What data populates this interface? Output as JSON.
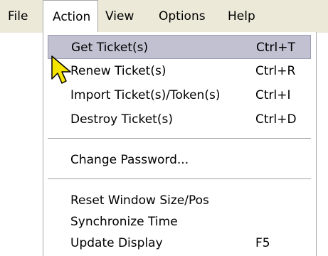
{
  "menubar": {
    "items": [
      {
        "label": "File"
      },
      {
        "label": "Action"
      },
      {
        "label": "View"
      },
      {
        "label": "Options"
      },
      {
        "label": "Help"
      }
    ]
  },
  "action_menu": {
    "items": [
      {
        "label": "Get Ticket(s)",
        "shortcut": "Ctrl+T",
        "highlighted": true
      },
      {
        "label": "Renew Ticket(s)",
        "shortcut": "Ctrl+R"
      },
      {
        "label": "Import Ticket(s)/Token(s)",
        "shortcut": "Ctrl+I"
      },
      {
        "label": "Destroy Ticket(s)",
        "shortcut": "Ctrl+D"
      },
      {
        "label": "Change Password..."
      },
      {
        "label": "Reset Window Size/Pos"
      },
      {
        "label": "Synchronize Time"
      },
      {
        "label": "Update Display",
        "shortcut": "F5"
      }
    ]
  },
  "colors": {
    "menubar_bg": "#ece9d8",
    "highlight_bg": "#c1c1d1",
    "cursor_fill": "#f5e300"
  },
  "cursor": {
    "icon": "arrow-pointer-icon"
  }
}
